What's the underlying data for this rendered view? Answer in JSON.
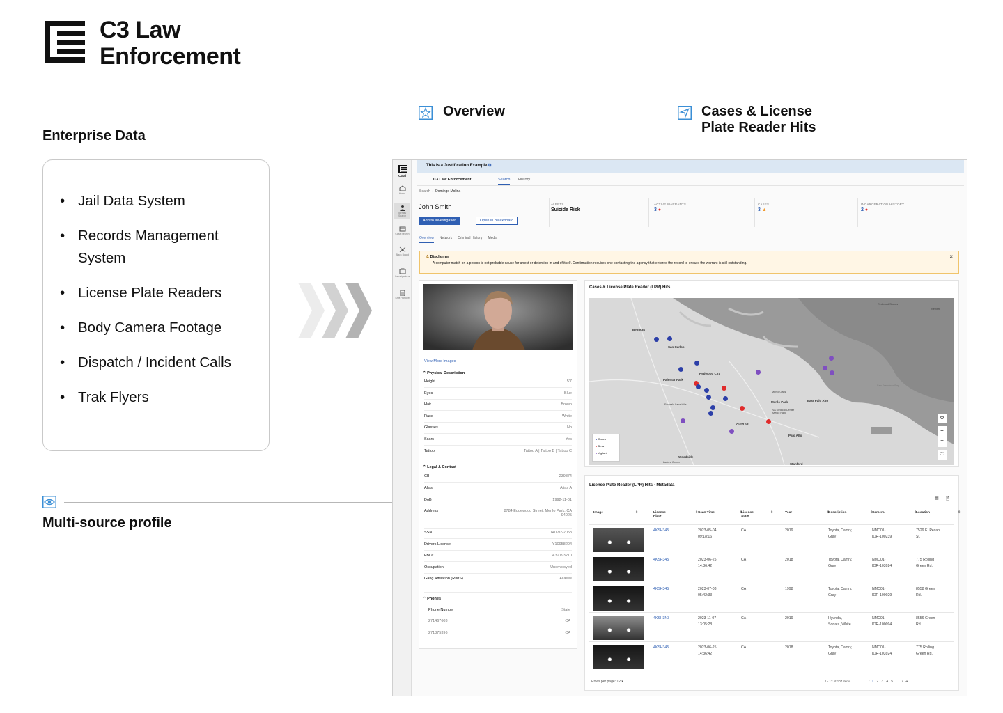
{
  "brand": {
    "line1": "C3 Law",
    "line2": "Enforcement"
  },
  "enterprise": {
    "title": "Enterprise Data",
    "items": [
      "Jail Data System",
      "Records Management System",
      "License Plate Readers",
      "Body Camera Footage",
      "Dispatch / Incident Calls",
      "Trak Flyers"
    ]
  },
  "callouts": {
    "overview": "Overview",
    "cases_line1": "Cases & License",
    "cases_line2": "Plate Reader Hits",
    "multi_source": "Multi-source profile"
  },
  "app": {
    "sidebar": [
      "C3.ai",
      "Home",
      "Identity Search",
      "Case Search",
      "Black Board",
      "Investigations",
      "Shift Handoff"
    ],
    "banner": "This is a Justification Example",
    "nav": {
      "app": "C3 Law Enforcement",
      "tab_search": "Search",
      "tab_history": "History"
    },
    "breadcrumb": {
      "root": "Search",
      "current": "Domingo Molina"
    },
    "person": {
      "name": "John Smith",
      "add_btn": "Add to Investigation",
      "open_btn": "Open in Blackboard"
    },
    "stats": [
      {
        "label": "ALERTS",
        "value": "Suicide Risk"
      },
      {
        "label": "ACTIVE WARRANTS",
        "value": "3"
      },
      {
        "label": "CASES",
        "value": "3"
      },
      {
        "label": "INCARCERATION HISTORY",
        "value": "2"
      }
    ],
    "subtabs": [
      "Overview",
      "Network",
      "Criminal History",
      "Media"
    ],
    "disclaimer": {
      "title": "Disclaimer",
      "text": "A computer match on a person is not probable cause for arrest or detention in and of itself. Confirmation requires one contacting the agency that entered the record to ensure the warrant is still outstanding.",
      "close": "×"
    },
    "view_more": "View More Images",
    "physical": {
      "title": "Physical Description",
      "rows": [
        [
          "Height",
          "5'7"
        ],
        [
          "Eyes",
          "Blue"
        ],
        [
          "Hair",
          "Brown"
        ],
        [
          "Race",
          "White"
        ],
        [
          "Glasses",
          "No"
        ],
        [
          "Scars",
          "Yes"
        ],
        [
          "Tattoo",
          "Tattoo A | Tattoo B | Tattoo C"
        ]
      ]
    },
    "legal": {
      "title": "Legal & Contact",
      "rows": [
        [
          "CII",
          "239874"
        ],
        [
          "Alias",
          "Alias A"
        ],
        [
          "DoB",
          "1992-11-01"
        ],
        [
          "Address",
          "8784 Edgewood Street, Menlo Park, CA 94025"
        ],
        [
          "SSN",
          "140-92-2058"
        ],
        [
          "Drivers License",
          "Y10958204"
        ],
        [
          "FBI #",
          "A32193210"
        ],
        [
          "Occupation",
          "Unemployed"
        ],
        [
          "Gang Affiliation (RIMS)",
          "Aliases"
        ]
      ]
    },
    "phones": {
      "title": "Phones",
      "col1": "Phone Number",
      "col2": "State",
      "rows": [
        [
          "271467603",
          "CA"
        ],
        [
          "271375396",
          "CA"
        ]
      ]
    },
    "map": {
      "title": "Cases & License Plate Reader (LPR) Hits...",
      "places": [
        "Belmont",
        "San Carlos",
        "Redwood City",
        "Palomar Park",
        "Menlo Park",
        "East Palo Alto",
        "Atherton",
        "Palo Alto",
        "Woodside",
        "Stanford",
        "Newark",
        "Redwood Shores",
        "San Francisco Bay",
        "Menlo Oaks",
        "VA Medical Center Menlo Park",
        "Emerald Lake Hills",
        "Ladera Corner"
      ],
      "legend": [
        "Cases",
        "Bmw",
        "Vigilant"
      ],
      "colors": {
        "cases": "#2c3fa8",
        "bmw": "#e02b2b",
        "vigilant": "#7f4fc0"
      }
    },
    "lpr": {
      "title": "License Plate Reader (LPR) Hits - Metadata",
      "headers": [
        "Image",
        "License Plate",
        "Scan Time",
        "License State",
        "Year",
        "Description",
        "Camera",
        "Location"
      ],
      "rows": [
        {
          "plate": "4KSH345",
          "time1": "2023-05-04",
          "time2": "09:18:16",
          "state": "CA",
          "year": "2019",
          "desc1": "Toyota, Camry,",
          "desc2": "Gray",
          "cam1": "NMC01-",
          "cam2": "IOR-100239",
          "loc1": "7529 E. Pecan",
          "loc2": "St."
        },
        {
          "plate": "4KSH345",
          "time1": "2023-06-25",
          "time2": "14:36:42",
          "state": "CA",
          "year": "2018",
          "desc1": "Toyota, Camry,",
          "desc2": "Gray",
          "cam1": "NMC01-",
          "cam2": "IOR-103924",
          "loc1": "775 Rolling",
          "loc2": "Green Rd."
        },
        {
          "plate": "4KSH345",
          "time1": "2023-07-03",
          "time2": "05:42:33",
          "state": "CA",
          "year": "1998",
          "desc1": "Toyota, Camry,",
          "desc2": "Gray",
          "cam1": "NMC01-",
          "cam2": "IOR-100029",
          "loc1": "8558 Green",
          "loc2": "Rd."
        },
        {
          "plate": "4KSH3N3",
          "time1": "2023-11-07",
          "time2": "13:05:28",
          "state": "CA",
          "year": "2019",
          "desc1": "Hyundai,",
          "desc2": "Sonata, White",
          "cam1": "NMC01-",
          "cam2": "IOR-100094",
          "loc1": "8556 Green",
          "loc2": "Rd."
        },
        {
          "plate": "4KSH345",
          "time1": "2023-06-25",
          "time2": "14:36:42",
          "state": "CA",
          "year": "2018",
          "desc1": "Toyota, Camry,",
          "desc2": "Gray",
          "cam1": "NMC01-",
          "cam2": "IOR-103924",
          "loc1": "775 Rolling",
          "loc2": "Green Rd."
        }
      ],
      "rows_per_page_label": "Rows per page:",
      "rows_per_page": "12",
      "range": "1 - 12 of 107 items",
      "pages": [
        "1",
        "2",
        "3",
        "4",
        "5",
        "..."
      ]
    }
  }
}
